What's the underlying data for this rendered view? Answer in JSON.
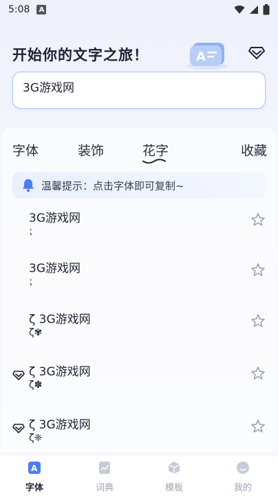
{
  "status_bar": {
    "time": "5:08",
    "notification_badge": "A"
  },
  "header": {
    "title": "开始你的文字之旅！"
  },
  "input": {
    "value": "3G游戏网"
  },
  "tabs": [
    {
      "label": "字体"
    },
    {
      "label": "装饰"
    },
    {
      "label": "花字",
      "active": true
    },
    {
      "label": "收藏"
    }
  ],
  "tip": {
    "text": "温馨提示：点击字体即可复制~"
  },
  "items": [
    {
      "text": "3G游戏网",
      "deco": "⁏",
      "vip": false
    },
    {
      "text": "3G游戏网",
      "deco": "⁏",
      "vip": false
    },
    {
      "text": "ζ 3G游戏网",
      "deco": "ζ✾",
      "vip": false
    },
    {
      "text": "ζ 3G游戏网",
      "deco": "ζ✽",
      "vip": true
    },
    {
      "text": "ζ 3G游戏网",
      "deco": "ζ❈",
      "vip": true
    }
  ],
  "bottom_nav": [
    {
      "label": "字体",
      "icon": "font-icon",
      "active": true
    },
    {
      "label": "词典",
      "icon": "dictionary-icon",
      "active": false
    },
    {
      "label": "模板",
      "icon": "template-icon",
      "active": false
    },
    {
      "label": "我的",
      "icon": "profile-icon",
      "active": false
    }
  ],
  "colors": {
    "accent": "#4a7ef7",
    "background": "#f4f6fc",
    "text": "#1f2433",
    "nav_inactive": "#9ca3b3"
  }
}
